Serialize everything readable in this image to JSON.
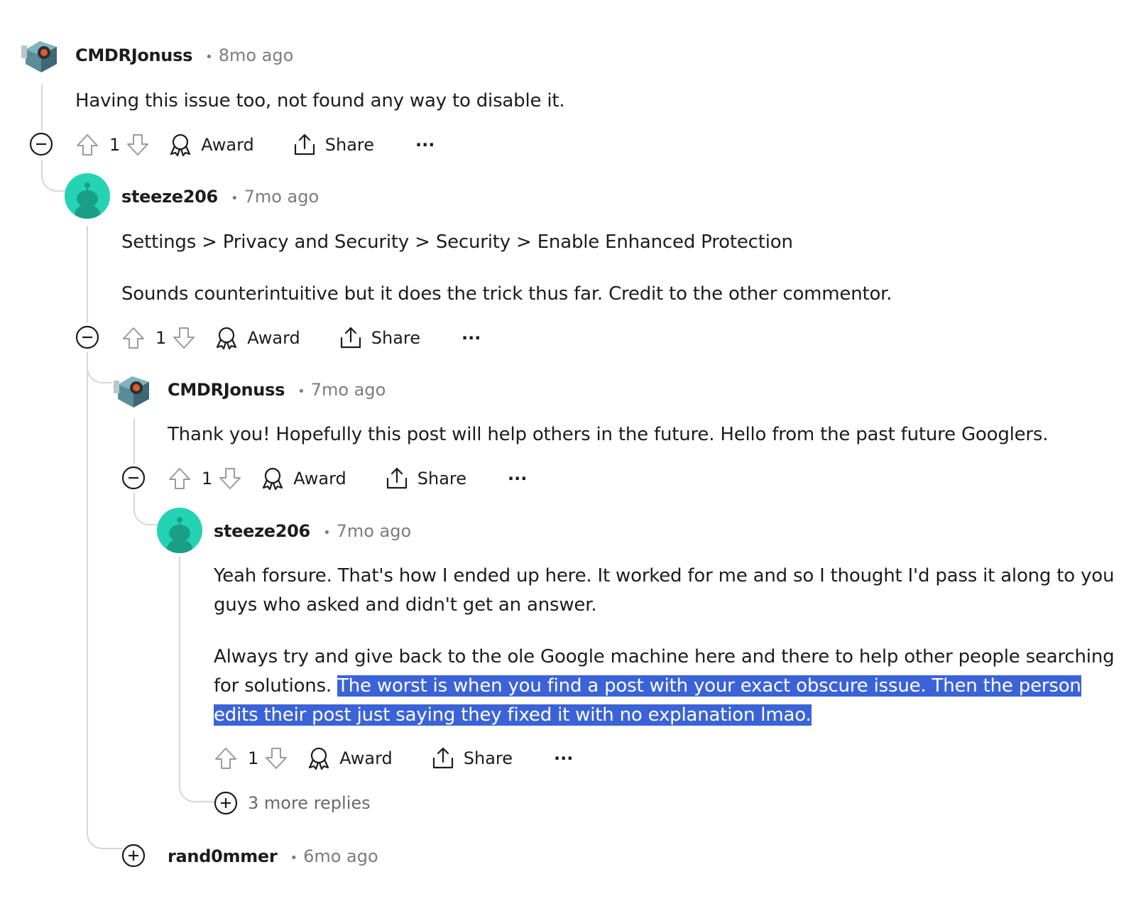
{
  "comments": [
    {
      "username": "CMDRJonuss",
      "dot": "•",
      "age": "8mo ago",
      "lines": [
        "Having this issue too, not found any way to disable it."
      ],
      "votes": "1",
      "award": "Award",
      "share": "Share",
      "more": "···"
    },
    {
      "username": "steeze206",
      "dot": "•",
      "age": "7mo ago",
      "lines": [
        "Settings > Privacy and Security > Security > Enable Enhanced Protection",
        "Sounds counterintuitive but it does the trick thus far. Credit to the other commentor."
      ],
      "votes": "1",
      "award": "Award",
      "share": "Share",
      "more": "···"
    },
    {
      "username": "CMDRJonuss",
      "dot": "•",
      "age": "7mo ago",
      "lines": [
        "Thank you! Hopefully this post will help others in the future. Hello from the past future Googlers."
      ],
      "votes": "1",
      "award": "Award",
      "share": "Share",
      "more": "···"
    },
    {
      "username": "steeze206",
      "dot": "•",
      "age": "7mo ago",
      "lines": [
        "Yeah forsure. That's how I ended up here. It worked for me and so I thought I'd pass it along to you",
        "guys who asked and didn't get an answer.",
        "Always try and give back to the ole Google machine here and there to help other people searching",
        "for solutions. ",
        "The worst is when you find a post with your exact obscure issue. Then the person",
        "edits their post just saying they fixed it with no explanation lmao."
      ],
      "votes": "1",
      "award": "Award",
      "share": "Share",
      "more": "···"
    },
    {
      "username": "rand0mmer",
      "dot": "•",
      "age": "6mo ago"
    }
  ],
  "more_replies": "3 more replies",
  "colors": {
    "selection_highlight": "#3b63d8",
    "thread_line": "#d4d7d9",
    "avatar_teal": "#24d3b3",
    "meta_grey": "#7c7c7c"
  },
  "icons": [
    "robot-avatar",
    "snoo-avatar",
    "collapse-icon",
    "expand-icon",
    "upvote-icon",
    "downvote-icon",
    "award-icon",
    "share-icon",
    "more-icon"
  ]
}
